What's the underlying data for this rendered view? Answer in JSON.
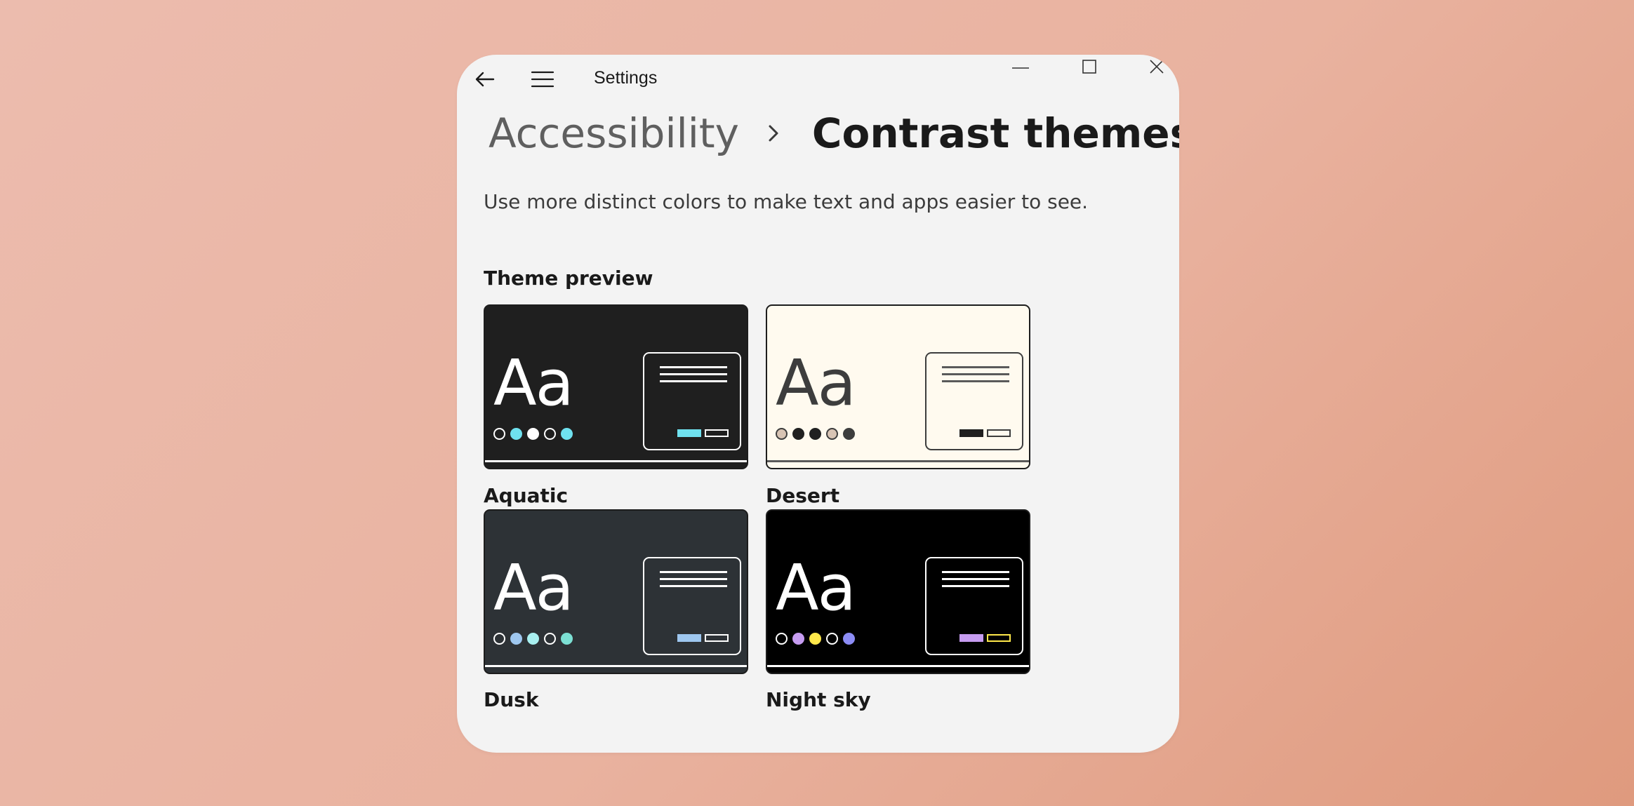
{
  "window": {
    "title": "Settings"
  },
  "breadcrumb": {
    "parent": "Accessibility",
    "current": "Contrast themes"
  },
  "description": "Use more distinct colors to make text and apps easier to see.",
  "theme_preview": {
    "heading": "Theme preview",
    "themes": [
      {
        "name": "Aquatic",
        "aa": "Aa",
        "bg": "#1f1f1f",
        "text": "#ffffff",
        "panel_border": "#ffffff",
        "line": "#ffffff",
        "dots": [
          {
            "fill": "#1f1f1f",
            "border": "#ffffff"
          },
          {
            "fill": "#6fe1ef",
            "border": "#6fe1ef"
          },
          {
            "fill": "#ffffff",
            "border": "#ffffff"
          },
          {
            "fill": "#1f1f1f",
            "border": "#ffffff"
          },
          {
            "fill": "#6fe1ef",
            "border": "#6fe1ef"
          }
        ],
        "btn1_fill": "#6fe1ef",
        "btn2_border": "#ffffff"
      },
      {
        "name": "Desert",
        "aa": "Aa",
        "bg": "#fffaef",
        "text": "#3d3d3d",
        "panel_border": "#3d3d3d",
        "line": "#5a5a5a",
        "dots": [
          {
            "fill": "#d8c4b4",
            "border": "#3d3d3d"
          },
          {
            "fill": "#202020",
            "border": "#202020"
          },
          {
            "fill": "#202020",
            "border": "#202020"
          },
          {
            "fill": "#d8c4b4",
            "border": "#3d3d3d"
          },
          {
            "fill": "#3d3d3d",
            "border": "#3d3d3d"
          }
        ],
        "btn1_fill": "#202020",
        "btn2_border": "#3d3d3d"
      },
      {
        "name": "Dusk",
        "aa": "Aa",
        "bg": "#2d3236",
        "text": "#ffffff",
        "panel_border": "#ffffff",
        "line": "#ffffff",
        "dots": [
          {
            "fill": "#2d3236",
            "border": "#ffffff"
          },
          {
            "fill": "#9ec7ef",
            "border": "#9ec7ef"
          },
          {
            "fill": "#a8f0f0",
            "border": "#a8f0f0"
          },
          {
            "fill": "#2d3236",
            "border": "#ffffff"
          },
          {
            "fill": "#7ce0d4",
            "border": "#7ce0d4"
          }
        ],
        "btn1_fill": "#9ec7ef",
        "btn2_border": "#ffffff"
      },
      {
        "name": "Night sky",
        "aa": "Aa",
        "bg": "#000000",
        "text": "#ffffff",
        "panel_border": "#ffffff",
        "line": "#ffffff",
        "dots": [
          {
            "fill": "#000000",
            "border": "#ffffff"
          },
          {
            "fill": "#c69cf0",
            "border": "#c69cf0"
          },
          {
            "fill": "#ffe84a",
            "border": "#ffe84a"
          },
          {
            "fill": "#000000",
            "border": "#ffffff"
          },
          {
            "fill": "#8c8cf5",
            "border": "#8c8cf5"
          }
        ],
        "btn1_fill": "#c69cf0",
        "btn2_border": "#ffe84a"
      }
    ]
  }
}
